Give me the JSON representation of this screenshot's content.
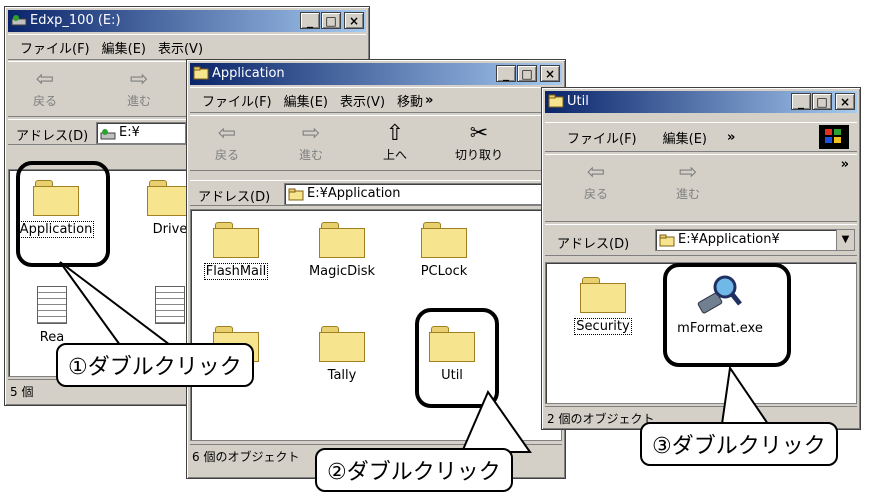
{
  "windows": {
    "edxp": {
      "title": "Edxp_100 (E:)",
      "menu": [
        "ファイル(F)",
        "編集(E)",
        "表示(V)"
      ],
      "tools": {
        "back": "戻る",
        "forward": "進む"
      },
      "address_label": "アドレス(D)",
      "address_value": "E:¥",
      "items": [
        {
          "label": "Application"
        },
        {
          "label": "Drive"
        },
        {
          "label": "Rea"
        },
        {
          "label": ""
        }
      ],
      "status": "5 個"
    },
    "application": {
      "title": "Application",
      "menu": [
        "ファイル(F)",
        "編集(E)",
        "表示(V)",
        "移動",
        "»"
      ],
      "tools": {
        "back": "戻る",
        "forward": "進む",
        "up": "上へ",
        "cut": "切り取り"
      },
      "address_label": "アドレス(D)",
      "address_value": "E:¥Application",
      "items": [
        {
          "label": "FlashMail"
        },
        {
          "label": "MagicDisk"
        },
        {
          "label": "PCLock"
        },
        {
          "label": ""
        },
        {
          "label": "Tally"
        },
        {
          "label": "Util"
        }
      ],
      "status": "6 個のオブジェクト"
    },
    "util": {
      "title": "Util",
      "menu": [
        "ファイル(F)",
        "編集(E)",
        "»"
      ],
      "tools": {
        "back": "戻る",
        "forward": "進む",
        "more": "»"
      },
      "address_label": "アドレス(D)",
      "address_value": "E:¥Application¥",
      "items": [
        {
          "label": "Security"
        },
        {
          "label": "mFormat.exe"
        }
      ],
      "status": "2 個のオブジェクト"
    }
  },
  "titlebar_buttons": {
    "minimize": "_",
    "maximize": "□",
    "close": "×"
  },
  "callouts": {
    "first": "①ダブルクリック",
    "second": "②ダブルクリック",
    "third": "③ダブルクリック"
  },
  "icons": {
    "folder": "folder-icon",
    "document": "document-icon",
    "exe": "magnifier-usb-icon",
    "windows_logo": "windows-logo-icon"
  },
  "colors": {
    "titlebar_start": "#0a246a",
    "titlebar_end": "#a6caf0",
    "window_face": "#d4d0c8",
    "folder_fill": "#f6e58e"
  }
}
